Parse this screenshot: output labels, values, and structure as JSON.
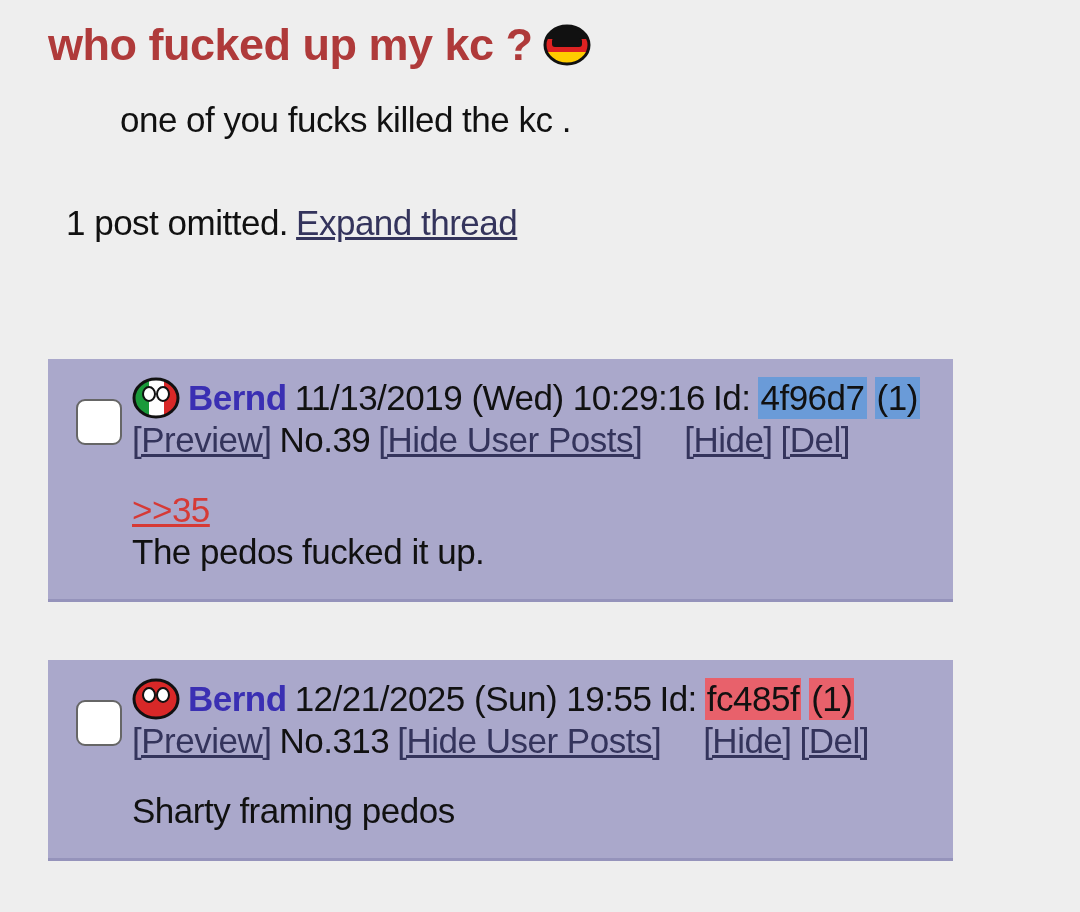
{
  "thread": {
    "title": "who fucked up my kc ?",
    "kind": "de",
    "body": "one of you fucks killed the kc .",
    "omitted": "1 post omitted.",
    "expand_link": "Expand thread"
  },
  "posts": [
    {
      "kind": "it",
      "name": "Bernd",
      "date": "11/13/2019 (Wed) 10:29:16",
      "id_label": "Id:",
      "id": "4f96d7",
      "id_count": "(1)",
      "color": "#6a9bd8",
      "preview": "[Preview]",
      "number": "No.39",
      "hide_user": "[Hide User Posts]",
      "hide": "[Hide]",
      "del": "[Del]",
      "checked": false,
      "quote": ">>35",
      "text": "The pedos fucked it up."
    },
    {
      "kind": "red",
      "name": "Bernd",
      "date": "12/21/2025 (Sun) 19:55",
      "id_label": "Id:",
      "id": "fc485f",
      "id_count": "(1)",
      "color": "#e8616b",
      "preview": "[Preview]",
      "number": "No.313",
      "hide_user": "[Hide User Posts]",
      "hide": "[Hide]",
      "del": "[Del]",
      "checked": false,
      "text": "Sharty framing pedos"
    }
  ]
}
